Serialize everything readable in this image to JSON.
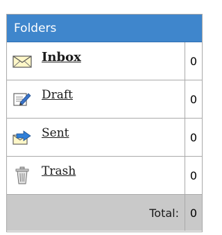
{
  "header": {
    "title": "Folders"
  },
  "folders": [
    {
      "label": "Inbox",
      "count": "0",
      "icon": "envelope-icon",
      "active": true
    },
    {
      "label": "Draft",
      "count": "0",
      "icon": "draft-edit-icon",
      "active": false
    },
    {
      "label": "Sent",
      "count": "0",
      "icon": "sent-arrow-icon",
      "active": false
    },
    {
      "label": "Trash",
      "count": "0",
      "icon": "trash-can-icon",
      "active": false
    }
  ],
  "total": {
    "label": "Total:",
    "count": "0"
  },
  "colors": {
    "header_bg": "#3f86cc",
    "total_bg": "#c9c9c9",
    "border": "#a9a9a9"
  }
}
